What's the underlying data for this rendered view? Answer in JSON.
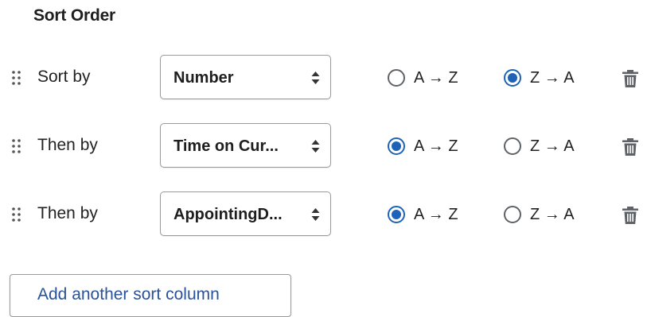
{
  "title": "Sort Order",
  "colors": {
    "accent": "#1e63b8",
    "link": "#2a5297",
    "border": "#9a9a9a"
  },
  "icons": {
    "drag": "drag-handle-icon",
    "caret": "chevron-up-down-icon",
    "delete": "trash-icon"
  },
  "rows": [
    {
      "label": "Sort by",
      "column": "Number",
      "asc_label": "A → Z",
      "desc_label": "Z → A",
      "direction": "desc"
    },
    {
      "label": "Then by",
      "column": "Time on Cur...",
      "asc_label": "A → Z",
      "desc_label": "Z → A",
      "direction": "asc"
    },
    {
      "label": "Then by",
      "column": "AppointingD...",
      "asc_label": "A → Z",
      "desc_label": "Z → A",
      "direction": "asc"
    }
  ],
  "add_button_label": "Add another sort column"
}
